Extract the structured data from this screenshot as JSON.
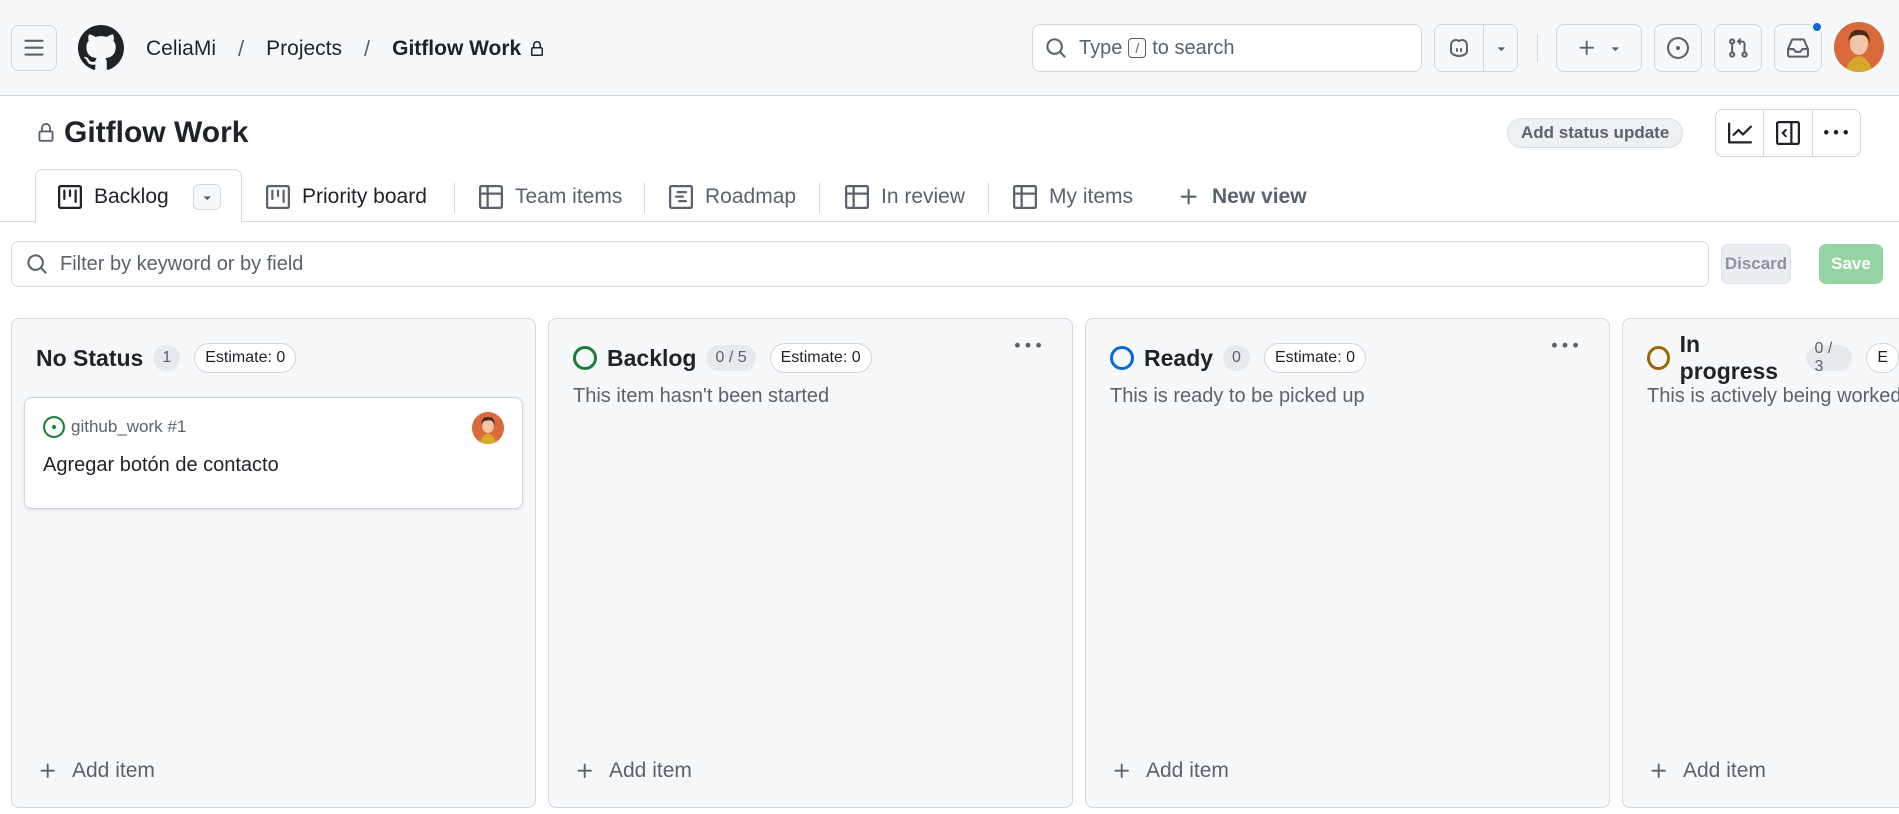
{
  "header": {
    "breadcrumb": {
      "owner": "CeliaMi",
      "section": "Projects",
      "project": "Gitflow Work",
      "separator": "/"
    },
    "search": {
      "prefix": "Type",
      "key": "/",
      "suffix": "to search"
    },
    "notification_color": "#0969da"
  },
  "project": {
    "title": "Gitflow Work",
    "status_update_label": "Add status update"
  },
  "tabs": [
    {
      "label": "Backlog",
      "icon": "board-icon",
      "active": true
    },
    {
      "label": "Priority board",
      "icon": "board-icon"
    },
    {
      "label": "Team items",
      "icon": "table-icon"
    },
    {
      "label": "Roadmap",
      "icon": "roadmap-icon"
    },
    {
      "label": "In review",
      "icon": "table-icon"
    },
    {
      "label": "My items",
      "icon": "table-icon"
    },
    {
      "label": "New view",
      "icon": "plus-icon"
    }
  ],
  "filter": {
    "placeholder": "Filter by keyword or by field",
    "discard_label": "Discard",
    "save_label": "Save"
  },
  "columns": [
    {
      "name": "No Status",
      "count": "1",
      "estimate": "Estimate: 0",
      "description": "",
      "status_color": "",
      "add_label": "Add item",
      "cards": [
        {
          "ref": "github_work #1",
          "title": "Agregar botón de contacto",
          "state_color": "#1a7f37"
        }
      ]
    },
    {
      "name": "Backlog",
      "count": "0 / 5",
      "estimate": "Estimate: 0",
      "description": "This item hasn't been started",
      "status_color": "#1a7f37",
      "add_label": "Add item"
    },
    {
      "name": "Ready",
      "count": "0",
      "estimate": "Estimate: 0",
      "description": "This is ready to be picked up",
      "status_color": "#0969da",
      "add_label": "Add item"
    },
    {
      "name": "In progress",
      "count": "0 / 3",
      "estimate": "E",
      "description": "This is actively being worked on",
      "status_color": "#9a6700",
      "add_label": "Add item"
    }
  ],
  "colors": {
    "accent_green": "#1a7f37",
    "accent_blue": "#0969da",
    "accent_yellow": "#9a6700",
    "save_disabled": "#94d3a2"
  }
}
